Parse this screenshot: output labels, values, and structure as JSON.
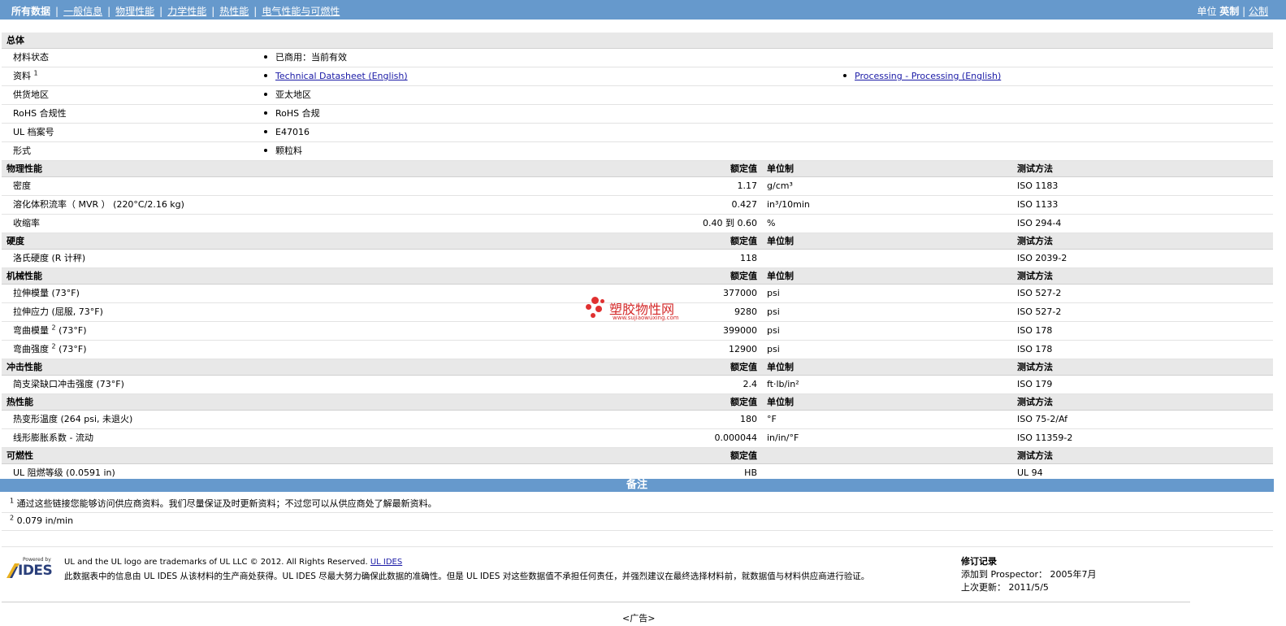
{
  "nav": {
    "items": [
      "所有数据",
      "一般信息",
      "物理性能",
      "力学性能",
      "热性能",
      "电气性能与可燃性"
    ],
    "units_label": "单位",
    "units_selected": "英制",
    "units_other": "公制"
  },
  "general": {
    "title": "总体",
    "rows": [
      {
        "name": "材料状态",
        "sup": "",
        "values": [
          "已商用：当前有效"
        ]
      },
      {
        "name": "资料",
        "sup": "1",
        "links": [
          "Technical Datasheet (English)",
          "Processing - Processing (English)"
        ]
      },
      {
        "name": "供货地区",
        "sup": "",
        "values": [
          "亚太地区"
        ]
      },
      {
        "name": "RoHS 合规性",
        "sup": "",
        "values": [
          "RoHS 合规"
        ]
      },
      {
        "name": "UL 档案号",
        "sup": "",
        "values": [
          "E47016"
        ]
      },
      {
        "name": "形式",
        "sup": "",
        "values": [
          "颗粒料"
        ]
      }
    ]
  },
  "sections": [
    {
      "title": "物理性能",
      "h_value": "额定值",
      "h_unit": "单位制",
      "h_method": "测试方法",
      "rows": [
        {
          "name": "密度",
          "value": "1.17",
          "unit": "g/cm³",
          "method": "ISO 1183"
        },
        {
          "name": "溶化体积流率（ MVR ） (220°C/2.16 kg)",
          "value": "0.427",
          "unit": "in³/10min",
          "method": "ISO 1133"
        },
        {
          "name": "收缩率",
          "value": "0.40 到  0.60",
          "unit": "%",
          "method": "ISO 294-4"
        }
      ]
    },
    {
      "title": "硬度",
      "h_value": "额定值",
      "h_unit": "单位制",
      "h_method": "测试方法",
      "rows": [
        {
          "name": "洛氏硬度 (R 计秤)",
          "value": "118",
          "unit": "",
          "method": "ISO 2039-2"
        }
      ]
    },
    {
      "title": "机械性能",
      "h_value": "额定值",
      "h_unit": "单位制",
      "h_method": "测试方法",
      "rows": [
        {
          "name": "拉伸模量 (73°F)",
          "value": "377000",
          "unit": "psi",
          "method": "ISO 527-2"
        },
        {
          "name": "拉伸应力 (屈服, 73°F)",
          "value": "9280",
          "unit": "psi",
          "method": "ISO 527-2"
        },
        {
          "name": "弯曲模量",
          "sup": "2",
          "suffix": " (73°F)",
          "value": "399000",
          "unit": "psi",
          "method": "ISO 178"
        },
        {
          "name": "弯曲强度",
          "sup": "2",
          "suffix": " (73°F)",
          "value": "12900",
          "unit": "psi",
          "method": "ISO 178"
        }
      ]
    },
    {
      "title": "冲击性能",
      "h_value": "额定值",
      "h_unit": "单位制",
      "h_method": "测试方法",
      "rows": [
        {
          "name": "简支梁缺口冲击强度 (73°F)",
          "value": "2.4",
          "unit": "ft·lb/in²",
          "method": "ISO 179"
        }
      ]
    },
    {
      "title": "热性能",
      "h_value": "额定值",
      "h_unit": "单位制",
      "h_method": "测试方法",
      "rows": [
        {
          "name": "热变形温度 (264 psi, 未退火)",
          "value": "180",
          "unit": "°F",
          "method": "ISO 75-2/Af"
        },
        {
          "name": "线形膨胀系数  - 流动",
          "value": "0.000044",
          "unit": "in/in/°F",
          "method": "ISO 11359-2"
        }
      ]
    },
    {
      "title": "可燃性",
      "h_value": "额定值",
      "h_unit": "",
      "h_method": "测试方法",
      "rows": [
        {
          "name": "UL 阻燃等级 (0.0591 in)",
          "value": "HB",
          "unit": "",
          "method": "UL 94"
        }
      ]
    }
  ],
  "notes": {
    "title": "备注",
    "items": [
      {
        "num": "1",
        "text": "通过这些链接您能够访问供应商资料。我们尽量保证及时更新资料；不过您可以从供应商处了解最新资料。"
      },
      {
        "num": "2",
        "text": "0.079 in/min"
      }
    ]
  },
  "footer": {
    "logo_small": "Powered by",
    "logo_text": "IDES",
    "line1": "UL and the UL logo are trademarks of UL LLC © 2012. All Rights Reserved.",
    "line1_link": "UL IDES",
    "line2": "此数据表中的信息由  UL IDES 从该材料的生产商处获得。UL IDES 尽最大努力确保此数据的准确性。但是  UL IDES 对这些数据值不承担任何责任，并强烈建议在最终选择材料前，就数据值与材料供应商进行验证。",
    "rev_title": "修订记录",
    "rev_added": "添加到  Prospector：  2005年7月",
    "rev_updated": "上次更新：  2011/5/5",
    "ad": "<广告>"
  },
  "watermark": {
    "text": "塑胶物性网",
    "url": "www.sujiaowuxing.com"
  }
}
